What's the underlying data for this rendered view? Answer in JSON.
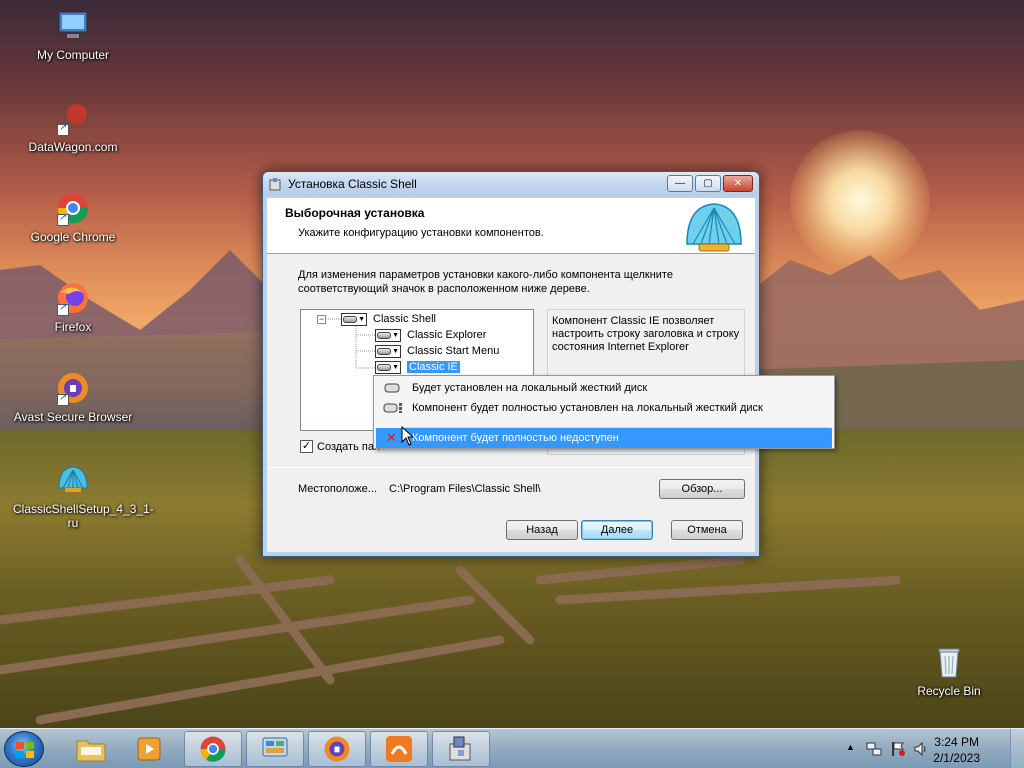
{
  "desktop": {
    "icons": [
      {
        "label": "My Computer"
      },
      {
        "label": "DataWagon.com"
      },
      {
        "label": "Google Chrome"
      },
      {
        "label": "Firefox"
      },
      {
        "label": "Avast Secure Browser"
      },
      {
        "label": "ClassicShellSetup_4_3_1-ru"
      },
      {
        "label": "Recycle Bin"
      }
    ]
  },
  "dialog": {
    "title": "Установка Classic Shell",
    "header_title": "Выборочная установка",
    "header_subtitle": "Укажите конфигурацию установки компонентов.",
    "instruction": "Для изменения параметров установки какого-либо компонента щелкните соответствующий значок в расположенном ниже дереве.",
    "tree": [
      {
        "label": "Classic Shell",
        "expander": "−"
      },
      {
        "label": "Classic Explorer"
      },
      {
        "label": "Classic Start Menu"
      },
      {
        "label": "Classic IE"
      }
    ],
    "description": "Компонент Classic IE позволяет настроить строку заголовка и строку состояния Internet Explorer",
    "checkbox_label": "Создать пан",
    "checkbox_checked": "✓",
    "location_label": "Местоположе...",
    "location_value": "C:\\Program Files\\Classic Shell\\",
    "browse_label": "Обзор...",
    "back_label": "Назад",
    "next_label": "Далее",
    "cancel_label": "Отмена",
    "win_min": "—",
    "win_max": "▢",
    "win_close": "✕"
  },
  "popup": {
    "items": [
      {
        "label": "Будет установлен на локальный жесткий диск"
      },
      {
        "label": "Компонент будет полностью установлен на локальный жесткий диск"
      },
      {
        "label": "Компонент будет полностью недоступен",
        "icon": "✕"
      }
    ]
  },
  "taskbar": {
    "time": "3:24 PM",
    "date": "2/1/2023",
    "tray_arrow": "▲"
  }
}
